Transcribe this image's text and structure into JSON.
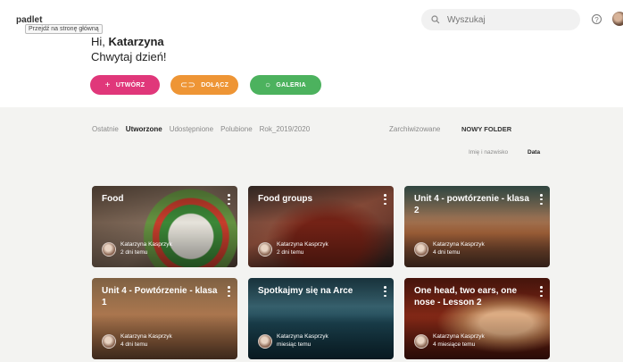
{
  "app": {
    "logo": "padlet",
    "tooltip": "Przejdź na stronę główną"
  },
  "search": {
    "placeholder": "Wyszukaj"
  },
  "help_label": "?",
  "greeting": {
    "hi": "Hi,",
    "name": "Katarzyna",
    "sub": "Chwytaj dzień!"
  },
  "actions": {
    "create": "UTWÓRZ",
    "join": "DOŁĄCZ",
    "gallery": "GALERIA"
  },
  "tabs": [
    "Ostatnie",
    "Utworzone",
    "Udostępnione",
    "Polubione",
    "Rok_2019/2020"
  ],
  "active_tab": "Utworzone",
  "archived": "Zarchiwizowane",
  "new_folder": "NOWY FOLDER",
  "sort": {
    "name": "Imię i nazwisko",
    "date": "Data",
    "active": "Data"
  },
  "cards": [
    {
      "title": "Food",
      "owner": "Katarzyna Kasprzyk",
      "when": "2 dni temu"
    },
    {
      "title": "Food groups",
      "owner": "Katarzyna Kasprzyk",
      "when": "2 dni temu"
    },
    {
      "title": "Unit 4 - powtórzenie - klasa 2",
      "owner": "Katarzyna Kasprzyk",
      "when": "4 dni temu"
    },
    {
      "title": "Unit 4 - Powtórzenie - klasa 1",
      "owner": "Katarzyna Kasprzyk",
      "when": "4 dni temu"
    },
    {
      "title": "Spotkajmy się na Arce",
      "owner": "Katarzyna Kasprzyk",
      "when": "miesiąc temu"
    },
    {
      "title": "One head, two ears, one nose - Lesson 2",
      "owner": "Katarzyna Kasprzyk",
      "when": "4 miesiące temu"
    }
  ],
  "colors": {
    "create": "#e0377a",
    "join": "#ee9535",
    "gallery": "#4cb25e",
    "background": "#f3f3f1"
  }
}
